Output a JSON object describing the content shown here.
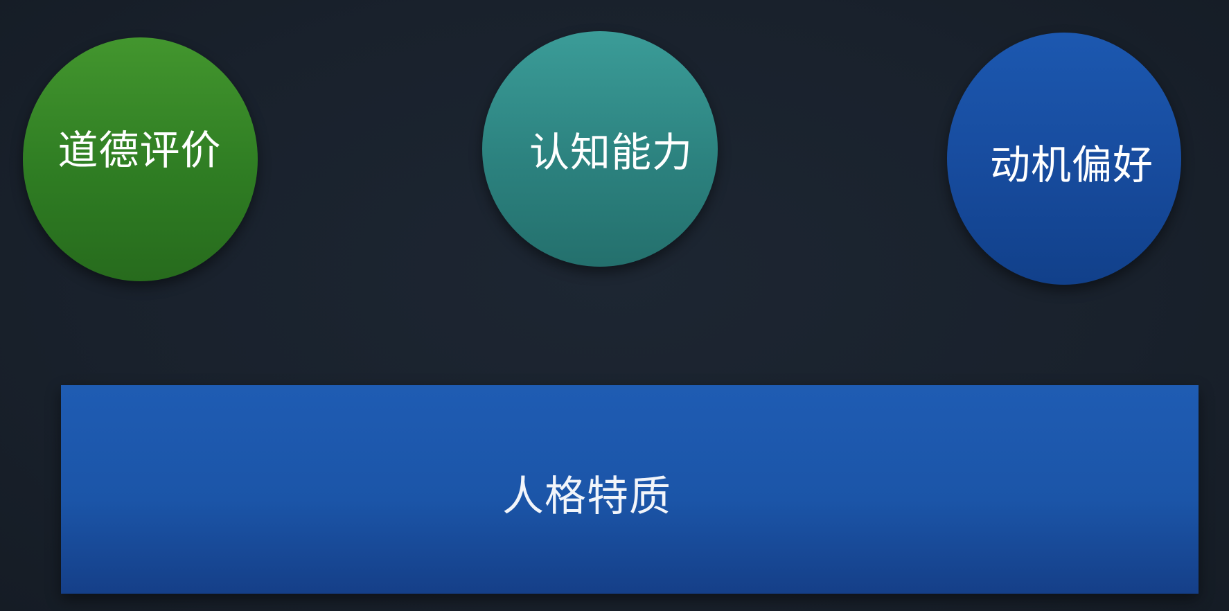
{
  "top_items": [
    {
      "label": "道德评价",
      "color": "#2f7d23"
    },
    {
      "label": "认知能力",
      "color": "#2c827f"
    },
    {
      "label": "动机偏好",
      "color": "#174b9d"
    }
  ],
  "base": {
    "label": "人格特质",
    "color": "#1b55a8"
  }
}
